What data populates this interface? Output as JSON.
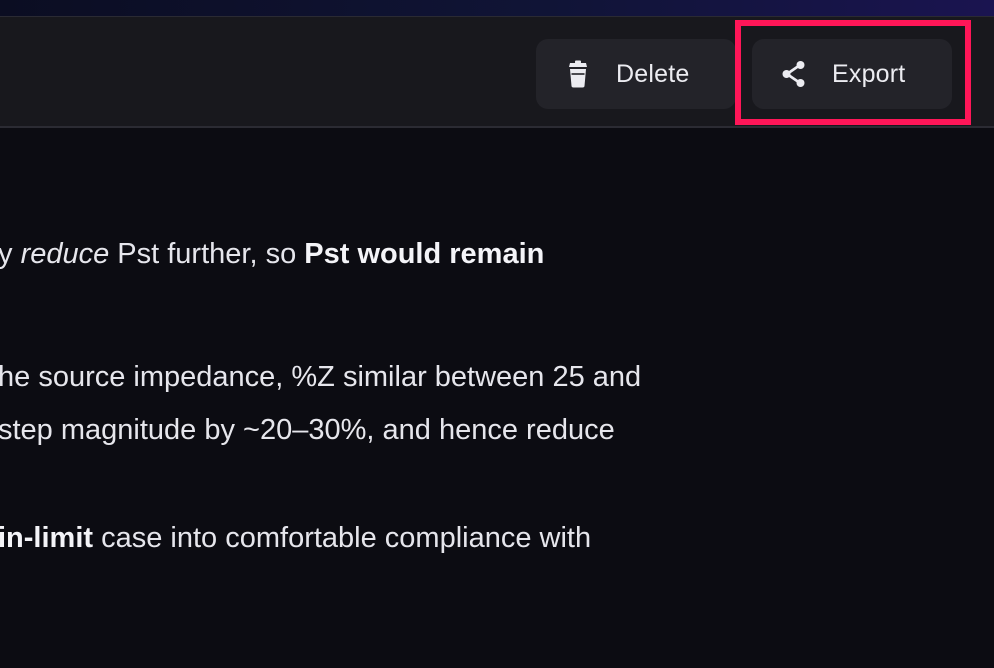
{
  "toolbar": {
    "delete_label": "Delete",
    "export_label": "Export"
  },
  "content": {
    "line1": {
      "prefix": "y ",
      "italic": "reduce",
      "middle": " Pst further, so ",
      "bold": "Pst would remain"
    },
    "line2": {
      "text": "he source impedance, %Z similar between 25 and"
    },
    "line3": {
      "text": "step magnitude by ~20–30%, and hence reduce"
    },
    "line4": {
      "bold": "in-limit",
      "rest": " case into comfortable compliance with"
    }
  },
  "colors": {
    "background": "#0c0c12",
    "toolbar": "#18181d",
    "button": "#232329",
    "highlight": "#ff1658",
    "text": "#e6e6ec"
  },
  "icons": {
    "delete": "trash-icon",
    "export": "share-icon"
  }
}
